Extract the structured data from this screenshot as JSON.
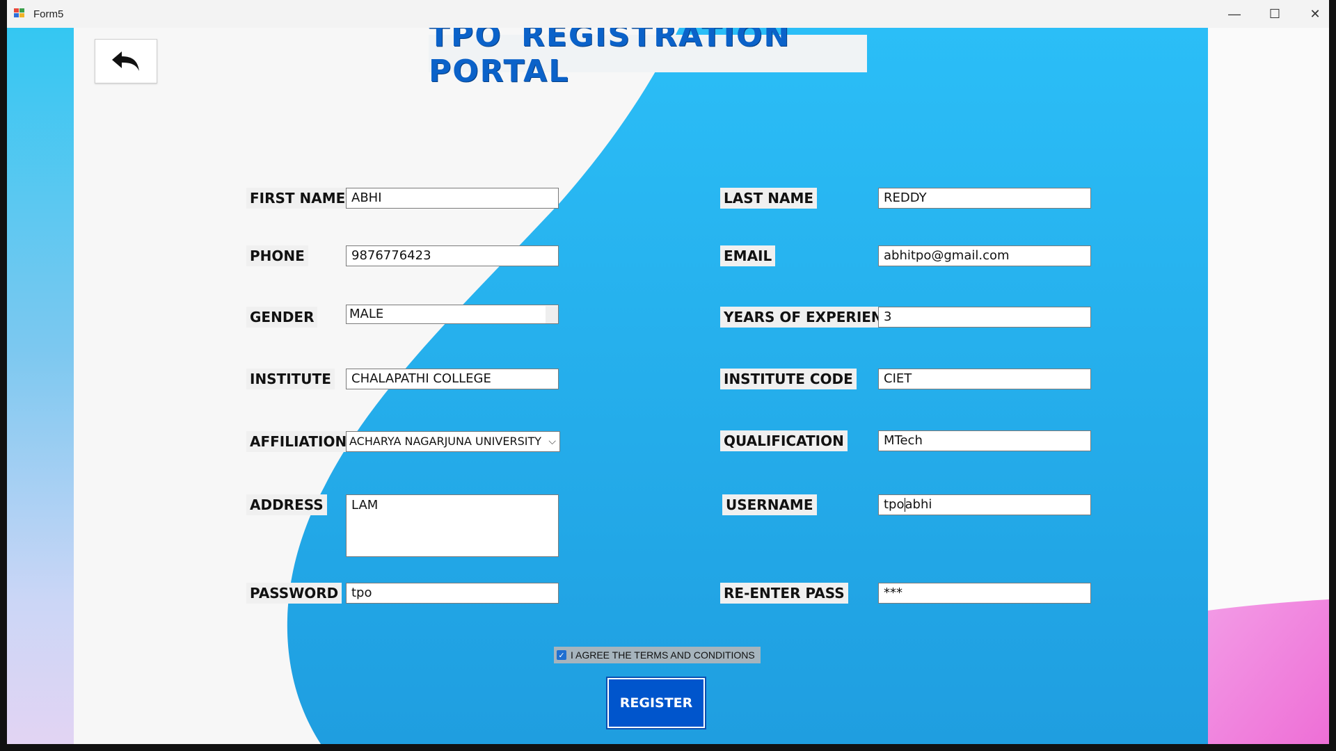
{
  "window": {
    "title": "Form5",
    "controls": {
      "minimize": "—",
      "maximize": "☐",
      "close": "✕"
    }
  },
  "header": {
    "title": "TPO REGISTRATION PORTAL"
  },
  "colors": {
    "accent": "#0b62c9",
    "panel_blue": "#2aa9e8",
    "register_bg": "#0055cc",
    "pink": "#f07bdc"
  },
  "form": {
    "first_name": {
      "label": "FIRST NAME",
      "value": "ABHI"
    },
    "last_name": {
      "label": "LAST NAME",
      "value": "REDDY"
    },
    "phone": {
      "label": "PHONE",
      "value": "9876776423"
    },
    "email": {
      "label": "EMAIL",
      "value": "abhitpo@gmail.com"
    },
    "gender": {
      "label": "GENDER",
      "value": "MALE"
    },
    "experience": {
      "label": "YEARS OF EXPERIENCE",
      "value": "3"
    },
    "institute": {
      "label": "INSTITUTE",
      "value": "CHALAPATHI COLLEGE"
    },
    "institute_code": {
      "label": "INSTITUTE CODE",
      "value": "CIET"
    },
    "affiliation": {
      "label": "AFFILIATION",
      "value": "ACHARYA NAGARJUNA UNIVERSITY"
    },
    "qualification": {
      "label": "QUALIFICATION",
      "value": "MTech"
    },
    "address": {
      "label": "ADDRESS",
      "value": "LAM"
    },
    "username": {
      "label": "USERNAME",
      "value_before_caret": "tpo",
      "value_after_caret": "abhi"
    },
    "password": {
      "label": "PASSWORD",
      "value": "tpo"
    },
    "reenter": {
      "label": "RE-ENTER PASS",
      "value": "***"
    }
  },
  "agree": {
    "label": "I AGREE THE TERMS AND CONDITIONS",
    "checked": true
  },
  "register": {
    "label": "REGISTER"
  },
  "icons": {
    "back": "back-arrow-icon",
    "checkbox": "check-icon",
    "dropdown": "chevron-down-icon"
  }
}
